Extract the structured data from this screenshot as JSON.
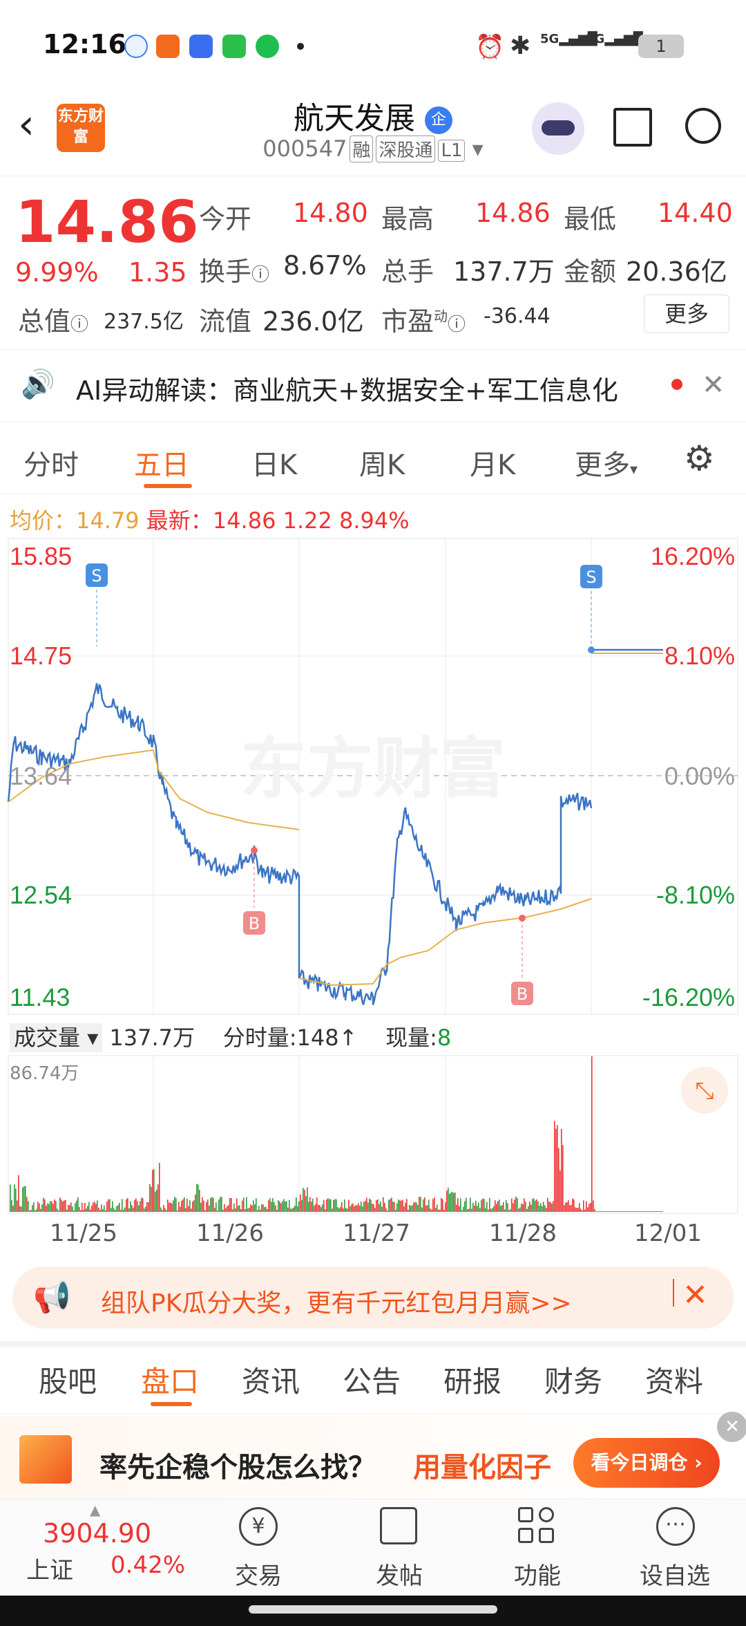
{
  "status": {
    "time": "12:16",
    "battery": "1",
    "signal1": "5G",
    "signal2": "5G"
  },
  "header": {
    "logo_text": "东方财富",
    "title": "航天发展",
    "title_badge": "企",
    "code": "000547",
    "badges": [
      "融",
      "深股通",
      "L1"
    ]
  },
  "quote": {
    "price": "14.86",
    "pct": "9.99%",
    "change": "1.35",
    "items": [
      {
        "label": "今开",
        "value": "14.80"
      },
      {
        "label": "最高",
        "value": "14.86"
      },
      {
        "label": "最低",
        "value": "14.40"
      },
      {
        "label": "换手",
        "value": "8.67%"
      },
      {
        "label": "总手",
        "value": "137.7万"
      },
      {
        "label": "金额",
        "value": "20.36亿"
      },
      {
        "label": "总值",
        "value": "237.5亿"
      },
      {
        "label": "流值",
        "value": "236.0亿"
      },
      {
        "label": "市盈",
        "value": "-36.44",
        "sup": "动"
      }
    ],
    "more_label": "更多"
  },
  "ai_banner": {
    "text": "AI异动解读：商业航天+数据安全+军工信息化"
  },
  "chart_tabs": [
    "分时",
    "五日",
    "日K",
    "周K",
    "月K",
    "更多"
  ],
  "active_chart_tab": "五日",
  "chart_info": {
    "avg_label": "均价：",
    "avg": "14.79",
    "latest_label": "最新：",
    "latest": "14.86",
    "chg": "1.22",
    "pct": "8.94%"
  },
  "chart_data": {
    "type": "line",
    "x": [
      "11/25",
      "11/26",
      "11/27",
      "11/28",
      "12/01"
    ],
    "y_left_ticks": [
      "15.85",
      "14.75",
      "13.64",
      "12.54",
      "11.43"
    ],
    "y_right_ticks": [
      "16.20%",
      "8.10%",
      "0.00%",
      "-8.10%",
      "-16.20%"
    ],
    "ylim": [
      11.43,
      15.85
    ],
    "series": [],
    "markers": [
      {
        "label": "S"
      },
      {
        "label": "B"
      },
      {
        "label": "B"
      },
      {
        "label": "S"
      }
    ],
    "watermark": "东方财富"
  },
  "volume": {
    "label": "成交量",
    "total": "137.7万",
    "minute_label": "分时量:",
    "minute_val": "148",
    "now_label": "现量:",
    "now_val": "8",
    "max": "86.74万"
  },
  "promo": {
    "text": "组队PK瓜分大奖，更有千元红包月月赢>>"
  },
  "bottom_tabs": [
    "股吧",
    "盘口",
    "资讯",
    "公告",
    "研报",
    "财务",
    "资料"
  ],
  "active_bottom_tab": "盘口",
  "ad": {
    "text1": "率先企稳个股怎么找？",
    "text2": "用量化因子",
    "button": "看今日调仓"
  },
  "footer": {
    "index_value": "3904.90",
    "index_name": "上证",
    "index_pct": "0.42%",
    "items": [
      "交易",
      "发帖",
      "功能",
      "设自选"
    ]
  }
}
